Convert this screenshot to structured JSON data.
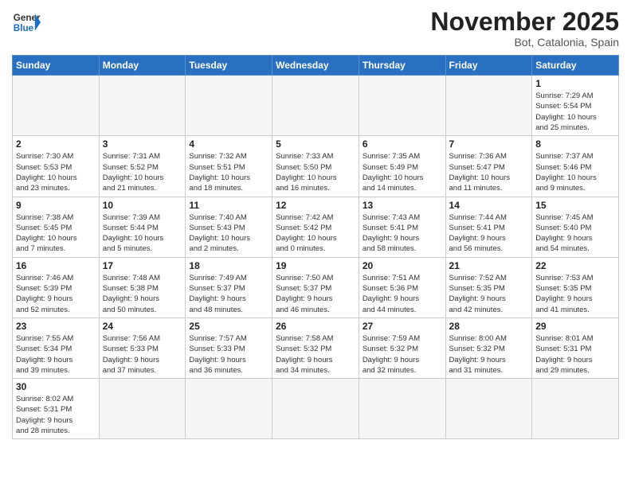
{
  "header": {
    "logo_general": "General",
    "logo_blue": "Blue",
    "month_title": "November 2025",
    "location": "Bot, Catalonia, Spain"
  },
  "weekdays": [
    "Sunday",
    "Monday",
    "Tuesday",
    "Wednesday",
    "Thursday",
    "Friday",
    "Saturday"
  ],
  "weeks": [
    [
      {
        "day": "",
        "info": ""
      },
      {
        "day": "",
        "info": ""
      },
      {
        "day": "",
        "info": ""
      },
      {
        "day": "",
        "info": ""
      },
      {
        "day": "",
        "info": ""
      },
      {
        "day": "",
        "info": ""
      },
      {
        "day": "1",
        "info": "Sunrise: 7:29 AM\nSunset: 5:54 PM\nDaylight: 10 hours\nand 25 minutes."
      }
    ],
    [
      {
        "day": "2",
        "info": "Sunrise: 7:30 AM\nSunset: 5:53 PM\nDaylight: 10 hours\nand 23 minutes."
      },
      {
        "day": "3",
        "info": "Sunrise: 7:31 AM\nSunset: 5:52 PM\nDaylight: 10 hours\nand 21 minutes."
      },
      {
        "day": "4",
        "info": "Sunrise: 7:32 AM\nSunset: 5:51 PM\nDaylight: 10 hours\nand 18 minutes."
      },
      {
        "day": "5",
        "info": "Sunrise: 7:33 AM\nSunset: 5:50 PM\nDaylight: 10 hours\nand 16 minutes."
      },
      {
        "day": "6",
        "info": "Sunrise: 7:35 AM\nSunset: 5:49 PM\nDaylight: 10 hours\nand 14 minutes."
      },
      {
        "day": "7",
        "info": "Sunrise: 7:36 AM\nSunset: 5:47 PM\nDaylight: 10 hours\nand 11 minutes."
      },
      {
        "day": "8",
        "info": "Sunrise: 7:37 AM\nSunset: 5:46 PM\nDaylight: 10 hours\nand 9 minutes."
      }
    ],
    [
      {
        "day": "9",
        "info": "Sunrise: 7:38 AM\nSunset: 5:45 PM\nDaylight: 10 hours\nand 7 minutes."
      },
      {
        "day": "10",
        "info": "Sunrise: 7:39 AM\nSunset: 5:44 PM\nDaylight: 10 hours\nand 5 minutes."
      },
      {
        "day": "11",
        "info": "Sunrise: 7:40 AM\nSunset: 5:43 PM\nDaylight: 10 hours\nand 2 minutes."
      },
      {
        "day": "12",
        "info": "Sunrise: 7:42 AM\nSunset: 5:42 PM\nDaylight: 10 hours\nand 0 minutes."
      },
      {
        "day": "13",
        "info": "Sunrise: 7:43 AM\nSunset: 5:41 PM\nDaylight: 9 hours\nand 58 minutes."
      },
      {
        "day": "14",
        "info": "Sunrise: 7:44 AM\nSunset: 5:41 PM\nDaylight: 9 hours\nand 56 minutes."
      },
      {
        "day": "15",
        "info": "Sunrise: 7:45 AM\nSunset: 5:40 PM\nDaylight: 9 hours\nand 54 minutes."
      }
    ],
    [
      {
        "day": "16",
        "info": "Sunrise: 7:46 AM\nSunset: 5:39 PM\nDaylight: 9 hours\nand 52 minutes."
      },
      {
        "day": "17",
        "info": "Sunrise: 7:48 AM\nSunset: 5:38 PM\nDaylight: 9 hours\nand 50 minutes."
      },
      {
        "day": "18",
        "info": "Sunrise: 7:49 AM\nSunset: 5:37 PM\nDaylight: 9 hours\nand 48 minutes."
      },
      {
        "day": "19",
        "info": "Sunrise: 7:50 AM\nSunset: 5:37 PM\nDaylight: 9 hours\nand 46 minutes."
      },
      {
        "day": "20",
        "info": "Sunrise: 7:51 AM\nSunset: 5:36 PM\nDaylight: 9 hours\nand 44 minutes."
      },
      {
        "day": "21",
        "info": "Sunrise: 7:52 AM\nSunset: 5:35 PM\nDaylight: 9 hours\nand 42 minutes."
      },
      {
        "day": "22",
        "info": "Sunrise: 7:53 AM\nSunset: 5:35 PM\nDaylight: 9 hours\nand 41 minutes."
      }
    ],
    [
      {
        "day": "23",
        "info": "Sunrise: 7:55 AM\nSunset: 5:34 PM\nDaylight: 9 hours\nand 39 minutes."
      },
      {
        "day": "24",
        "info": "Sunrise: 7:56 AM\nSunset: 5:33 PM\nDaylight: 9 hours\nand 37 minutes."
      },
      {
        "day": "25",
        "info": "Sunrise: 7:57 AM\nSunset: 5:33 PM\nDaylight: 9 hours\nand 36 minutes."
      },
      {
        "day": "26",
        "info": "Sunrise: 7:58 AM\nSunset: 5:32 PM\nDaylight: 9 hours\nand 34 minutes."
      },
      {
        "day": "27",
        "info": "Sunrise: 7:59 AM\nSunset: 5:32 PM\nDaylight: 9 hours\nand 32 minutes."
      },
      {
        "day": "28",
        "info": "Sunrise: 8:00 AM\nSunset: 5:32 PM\nDaylight: 9 hours\nand 31 minutes."
      },
      {
        "day": "29",
        "info": "Sunrise: 8:01 AM\nSunset: 5:31 PM\nDaylight: 9 hours\nand 29 minutes."
      }
    ],
    [
      {
        "day": "30",
        "info": "Sunrise: 8:02 AM\nSunset: 5:31 PM\nDaylight: 9 hours\nand 28 minutes."
      },
      {
        "day": "",
        "info": ""
      },
      {
        "day": "",
        "info": ""
      },
      {
        "day": "",
        "info": ""
      },
      {
        "day": "",
        "info": ""
      },
      {
        "day": "",
        "info": ""
      },
      {
        "day": "",
        "info": ""
      }
    ]
  ]
}
